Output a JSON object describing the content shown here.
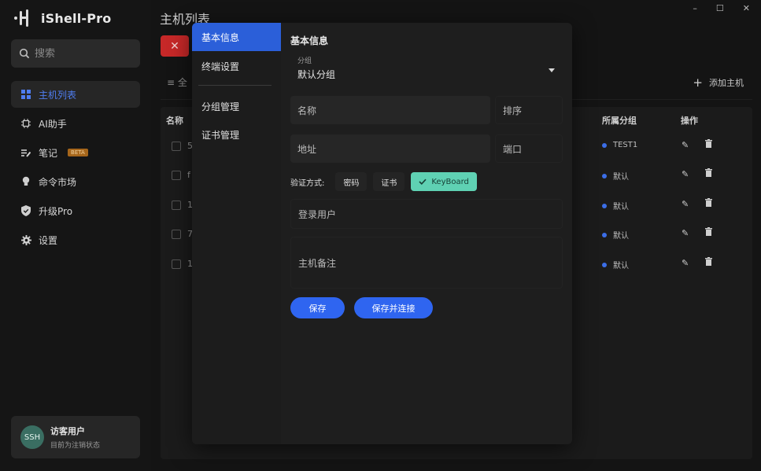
{
  "app": {
    "name": "iShell-Pro"
  },
  "window_controls": {
    "minimize": "–",
    "maximize": "☐",
    "close": "✕"
  },
  "sidebar": {
    "search_placeholder": "搜索",
    "items": [
      {
        "label": "主机列表",
        "icon": "grid-icon",
        "active": true
      },
      {
        "label": "AI助手",
        "icon": "chip-icon",
        "active": false
      },
      {
        "label": "笔记",
        "icon": "note-icon",
        "active": false,
        "badge": "BETA"
      },
      {
        "label": "命令市场",
        "icon": "bulb-icon",
        "active": false
      },
      {
        "label": "升级Pro",
        "icon": "shield-icon",
        "active": false
      },
      {
        "label": "设置",
        "icon": "gear-icon",
        "active": false
      }
    ],
    "user": {
      "avatar": "SSH",
      "name": "访客用户",
      "status": "目前为注销状态"
    }
  },
  "main": {
    "title": "主机列表",
    "delete_label": "✕",
    "filter_label": "≡ 全",
    "add_host_label": "添加主机",
    "table": {
      "headers": {
        "name": "名称",
        "group": "所属分组",
        "actions": "操作"
      },
      "rows": [
        {
          "name": "5",
          "group": "TEST1"
        },
        {
          "name": "f",
          "group": "默认"
        },
        {
          "name": "1",
          "group": "默认"
        },
        {
          "name": "7",
          "group": "默认"
        },
        {
          "name": "1",
          "group": "默认"
        }
      ]
    }
  },
  "modal": {
    "nav": [
      "基本信息",
      "终端设置",
      "分组管理",
      "证书管理"
    ],
    "section_title": "基本信息",
    "group": {
      "label": "分组",
      "value": "默认分组"
    },
    "fields": {
      "name": "名称",
      "order": "排序",
      "address": "地址",
      "port": "端口",
      "login_user": "登录用户",
      "remark": "主机备注"
    },
    "auth": {
      "label": "验证方式:",
      "options": [
        {
          "label": "密码",
          "selected": false
        },
        {
          "label": "证书",
          "selected": false
        },
        {
          "label": "KeyBoard",
          "selected": true
        }
      ]
    },
    "buttons": {
      "save": "保存",
      "save_connect": "保存并连接"
    }
  },
  "colors": {
    "accent": "#2f65f0",
    "active_nav": "#2b5fd9",
    "selected_chip": "#5fd1b3",
    "danger": "#c62828"
  }
}
